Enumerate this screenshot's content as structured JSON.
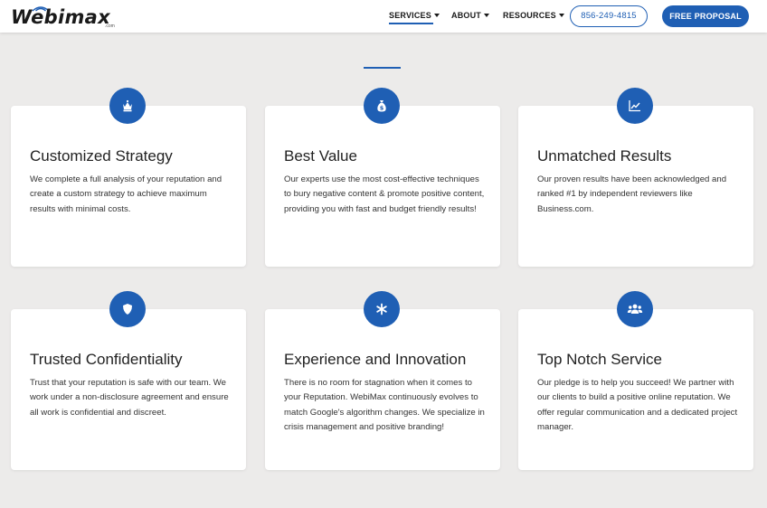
{
  "header": {
    "logo_text": "Webimax",
    "logo_sub": ".com",
    "nav": [
      {
        "label": "SERVICES"
      },
      {
        "label": "ABOUT"
      },
      {
        "label": "RESOURCES"
      }
    ],
    "phone_label": "856-249-4815",
    "proposal_label": "FREE PROPOSAL"
  },
  "colors": {
    "accent": "#1f5fb4",
    "background": "#ecebea",
    "card": "#ffffff"
  },
  "cards": [
    {
      "icon": "chess-king-icon",
      "title": "Customized Strategy",
      "text": "We complete a full analysis of your reputation and create a custom strategy to achieve maximum results with minimal costs."
    },
    {
      "icon": "money-bag-icon",
      "title": "Best Value",
      "text": "Our experts use the most cost-effective techniques to bury negative content & promote positive content, providing you with fast and budget friendly results!"
    },
    {
      "icon": "line-chart-icon",
      "title": "Unmatched Results",
      "text": "Our proven results have been acknowledged and ranked #1 by independent reviewers like Business.com."
    },
    {
      "icon": "shield-icon",
      "title": "Trusted Confidentiality",
      "text": "Trust that your reputation is safe with our team. We work under a non-disclosure agreement and ensure all work is confidential and discreet."
    },
    {
      "icon": "asterisk-icon",
      "title": "Experience and Innovation",
      "text": "There is no room for stagnation when it comes to your Reputation. WebiMax continuously evolves to match Google's algorithm changes. We specialize in crisis management and positive branding!"
    },
    {
      "icon": "users-icon",
      "title": "Top Notch Service",
      "text": "Our pledge is to help you succeed! We partner with our clients to build a positive online reputation. We offer regular communication and a dedicated project manager."
    }
  ]
}
